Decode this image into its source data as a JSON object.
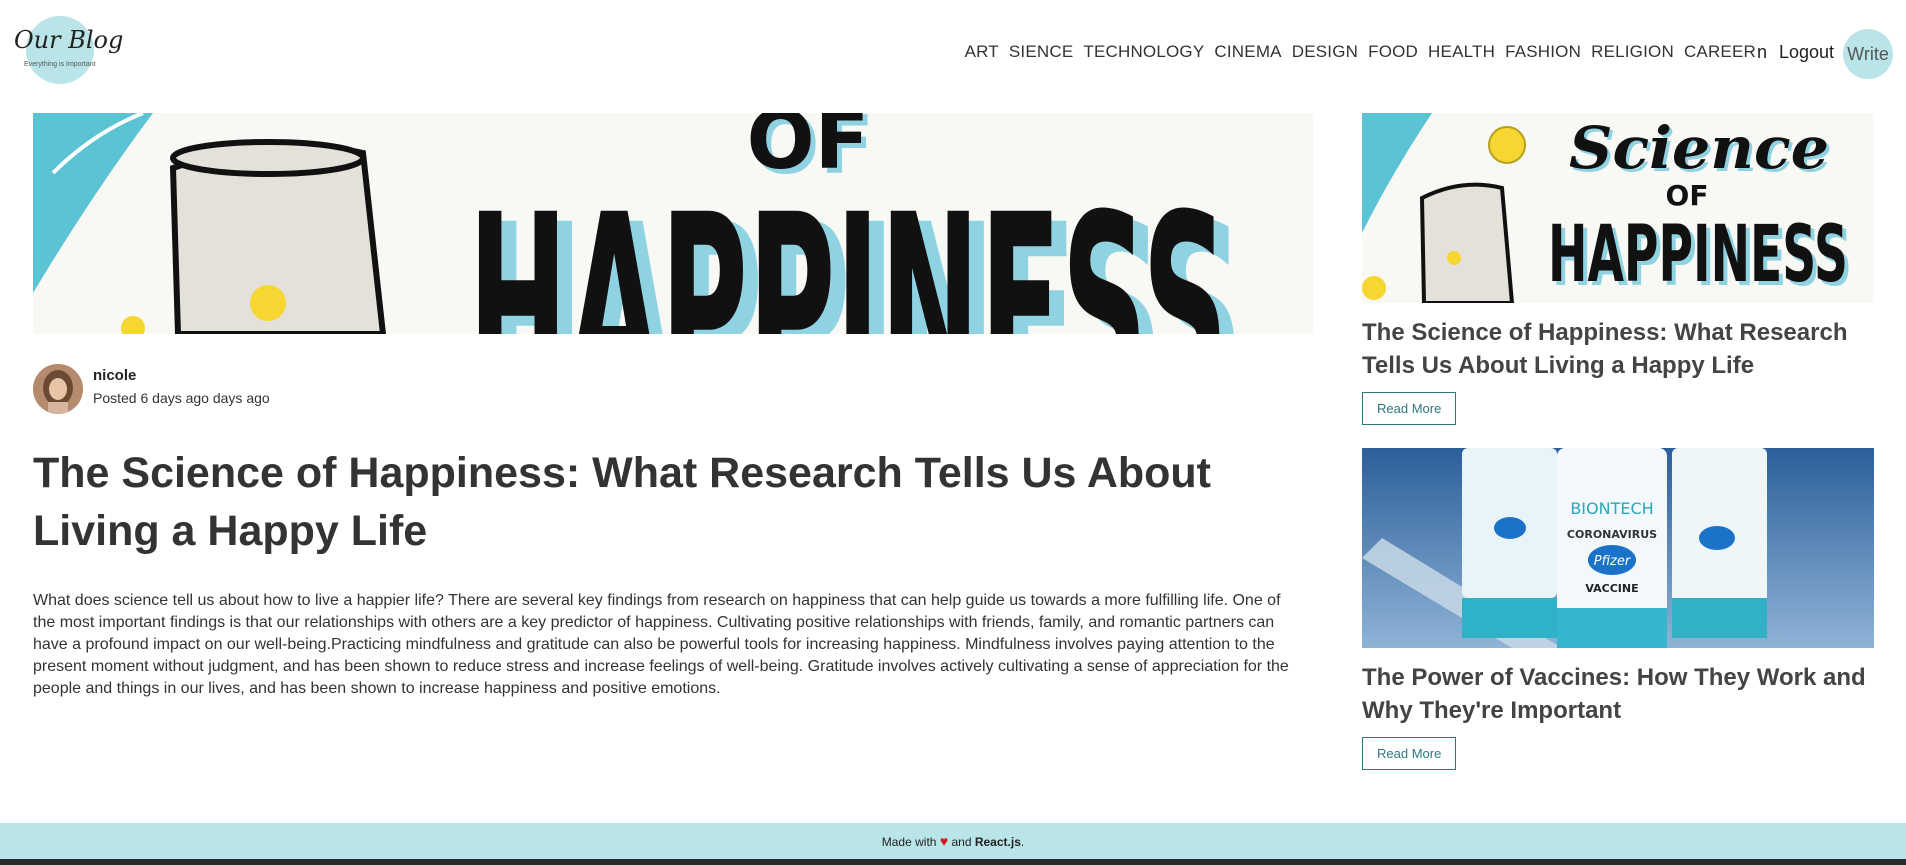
{
  "brand": {
    "title": "Our Blog",
    "tagline": "Everything is Important"
  },
  "nav": {
    "categories": [
      "ART",
      "SIENCE",
      "TECHNOLOGY",
      "CINEMA",
      "DESIGN",
      "FOOD",
      "HEALTH",
      "FASHION",
      "RELIGION",
      "CAREER"
    ],
    "user_initial": "n",
    "logout": "Logout",
    "write": "Write"
  },
  "post": {
    "author": "nicole",
    "posted": "Posted 6 days ago days ago",
    "title": "The Science of Happiness: What Research Tells Us About Living a Happy Life",
    "body": "What does science tell us about how to live a happier life? There are several key findings from research on happiness that can help guide us towards a more fulfilling life. One of the most important findings is that our relationships with others are a key predictor of happiness. Cultivating positive relationships with friends, family, and romantic partners can have a profound impact on our well-being.Practicing mindfulness and gratitude can also be powerful tools for increasing happiness. Mindfulness involves paying attention to the present moment without judgment, and has been shown to reduce stress and increase feelings of well-being. Gratitude involves actively cultivating a sense of appreciation for the people and things in our lives, and has been shown to increase happiness and positive emotions."
  },
  "sidebar": {
    "cards": [
      {
        "title": "The Science of Happiness: What Research Tells Us About Living a Happy Life",
        "button": "Read More"
      },
      {
        "title": "The Power of Vaccines: How They Work and Why They're Important",
        "button": "Read More"
      }
    ]
  },
  "images": {
    "hero_text": "HAPPINESS",
    "hero_of": "OF",
    "thumb_text": [
      "Science",
      "OF",
      "HAPPINESS"
    ],
    "vaccine_brand": "BIONTECH",
    "vaccine_sub": "CORONAVIRUS",
    "vaccine_pfizer": "Pfizer",
    "vaccine_label": "VACCINE"
  },
  "footer": {
    "made_with": "Made with",
    "and": "and",
    "tech": "React.js",
    "end": "."
  }
}
